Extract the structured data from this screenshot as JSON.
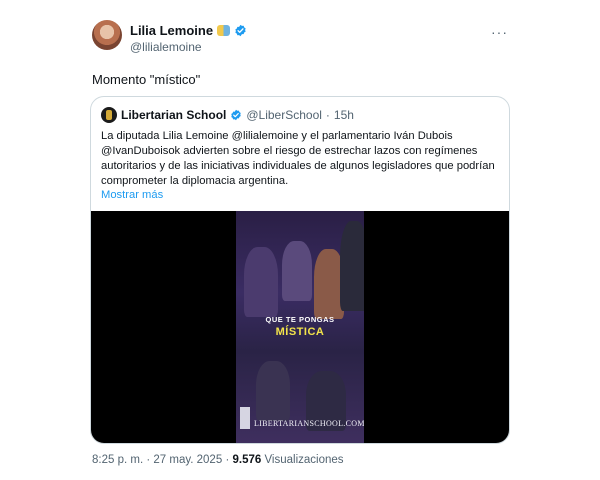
{
  "tweet": {
    "author_name": "Lilia Lemoine",
    "author_handle": "@lilialemoine",
    "more_label": "···",
    "text": "Momento \"místico\"",
    "time": "8:25 p. m.",
    "separator": "·",
    "date": "27 may. 2025",
    "views_count": "9.576",
    "views_label": "Visualizaciones"
  },
  "quote": {
    "author_name": "Libertarian School",
    "author_handle": "@LiberSchool",
    "separator": "·",
    "time_ago": "15h",
    "body": "La diputada Lilia Lemoine @lilialemoine  y el parlamentario Iván Dubois @IvanDuboisok advierten sobre el riesgo de estrechar lazos con regímenes autoritarios y de las iniciativas individuales de algunos legisladores que podrían comprometer la diplomacia argentina.",
    "show_more": "Mostrar más",
    "video": {
      "caption_line1": "QUE TE PONGAS",
      "caption_line2": "MÍSTICA",
      "watermark": "LIBERTARIANSCHOOL.COM"
    }
  },
  "colors": {
    "verified": "#1d9bf0",
    "link": "#1d9bf0",
    "caption_highlight": "#f2e34a",
    "secondary_text": "#536471"
  }
}
